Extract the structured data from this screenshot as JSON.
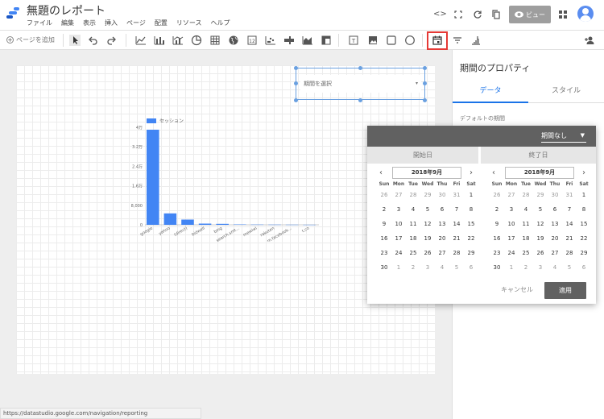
{
  "header": {
    "title": "無題のレポート",
    "menu": [
      "ファイル",
      "編集",
      "表示",
      "挿入",
      "ページ",
      "配置",
      "リソース",
      "ヘルプ"
    ],
    "view_label": "ビュー"
  },
  "toolbar": {
    "add_page": "ページを追加",
    "highlighted": "date-range-icon"
  },
  "canvas": {
    "date_control_placeholder": "期間を選択",
    "status_url": "https://datastudio.google.com/navigation/reporting"
  },
  "colors": {
    "bar": "#4285f4",
    "highlight": "#e53935",
    "accent": "#1a73e8",
    "popup_header": "#616161"
  },
  "chart_data": {
    "type": "bar",
    "legend": [
      "セッション"
    ],
    "categories": [
      "google",
      "yahoo",
      "(direct)",
      "bidwell",
      "bing",
      "search.smt...",
      "mewiwi",
      "rakuten",
      "m.facebook...",
      "t.co"
    ],
    "values": [
      4000,
      480,
      220,
      50,
      40,
      15,
      10,
      8,
      6,
      4
    ],
    "yticks": [
      "4万",
      "3.2万",
      "2.4万",
      "1.6万",
      "8,000",
      "0"
    ],
    "ylim": [
      0,
      4100
    ]
  },
  "right_panel": {
    "title": "期間のプロパティ",
    "tabs": [
      "データ",
      "スタイル"
    ],
    "default_period_label": "デフォルトの期間"
  },
  "date_popup": {
    "preset": "期間なし",
    "start_label": "開始日",
    "end_label": "終了日",
    "month": "2018年9月",
    "weekdays": [
      "Sun",
      "Mon",
      "Tue",
      "Wed",
      "Thu",
      "Fri",
      "Sat"
    ],
    "days": [
      [
        26,
        27,
        28,
        29,
        30,
        31,
        1
      ],
      [
        2,
        3,
        4,
        5,
        6,
        7,
        8
      ],
      [
        9,
        10,
        11,
        12,
        13,
        14,
        15
      ],
      [
        16,
        17,
        18,
        19,
        20,
        21,
        22
      ],
      [
        23,
        24,
        25,
        26,
        27,
        28,
        29
      ],
      [
        30,
        1,
        2,
        3,
        4,
        5,
        6
      ]
    ],
    "cancel": "キャンセル",
    "apply": "適用"
  }
}
